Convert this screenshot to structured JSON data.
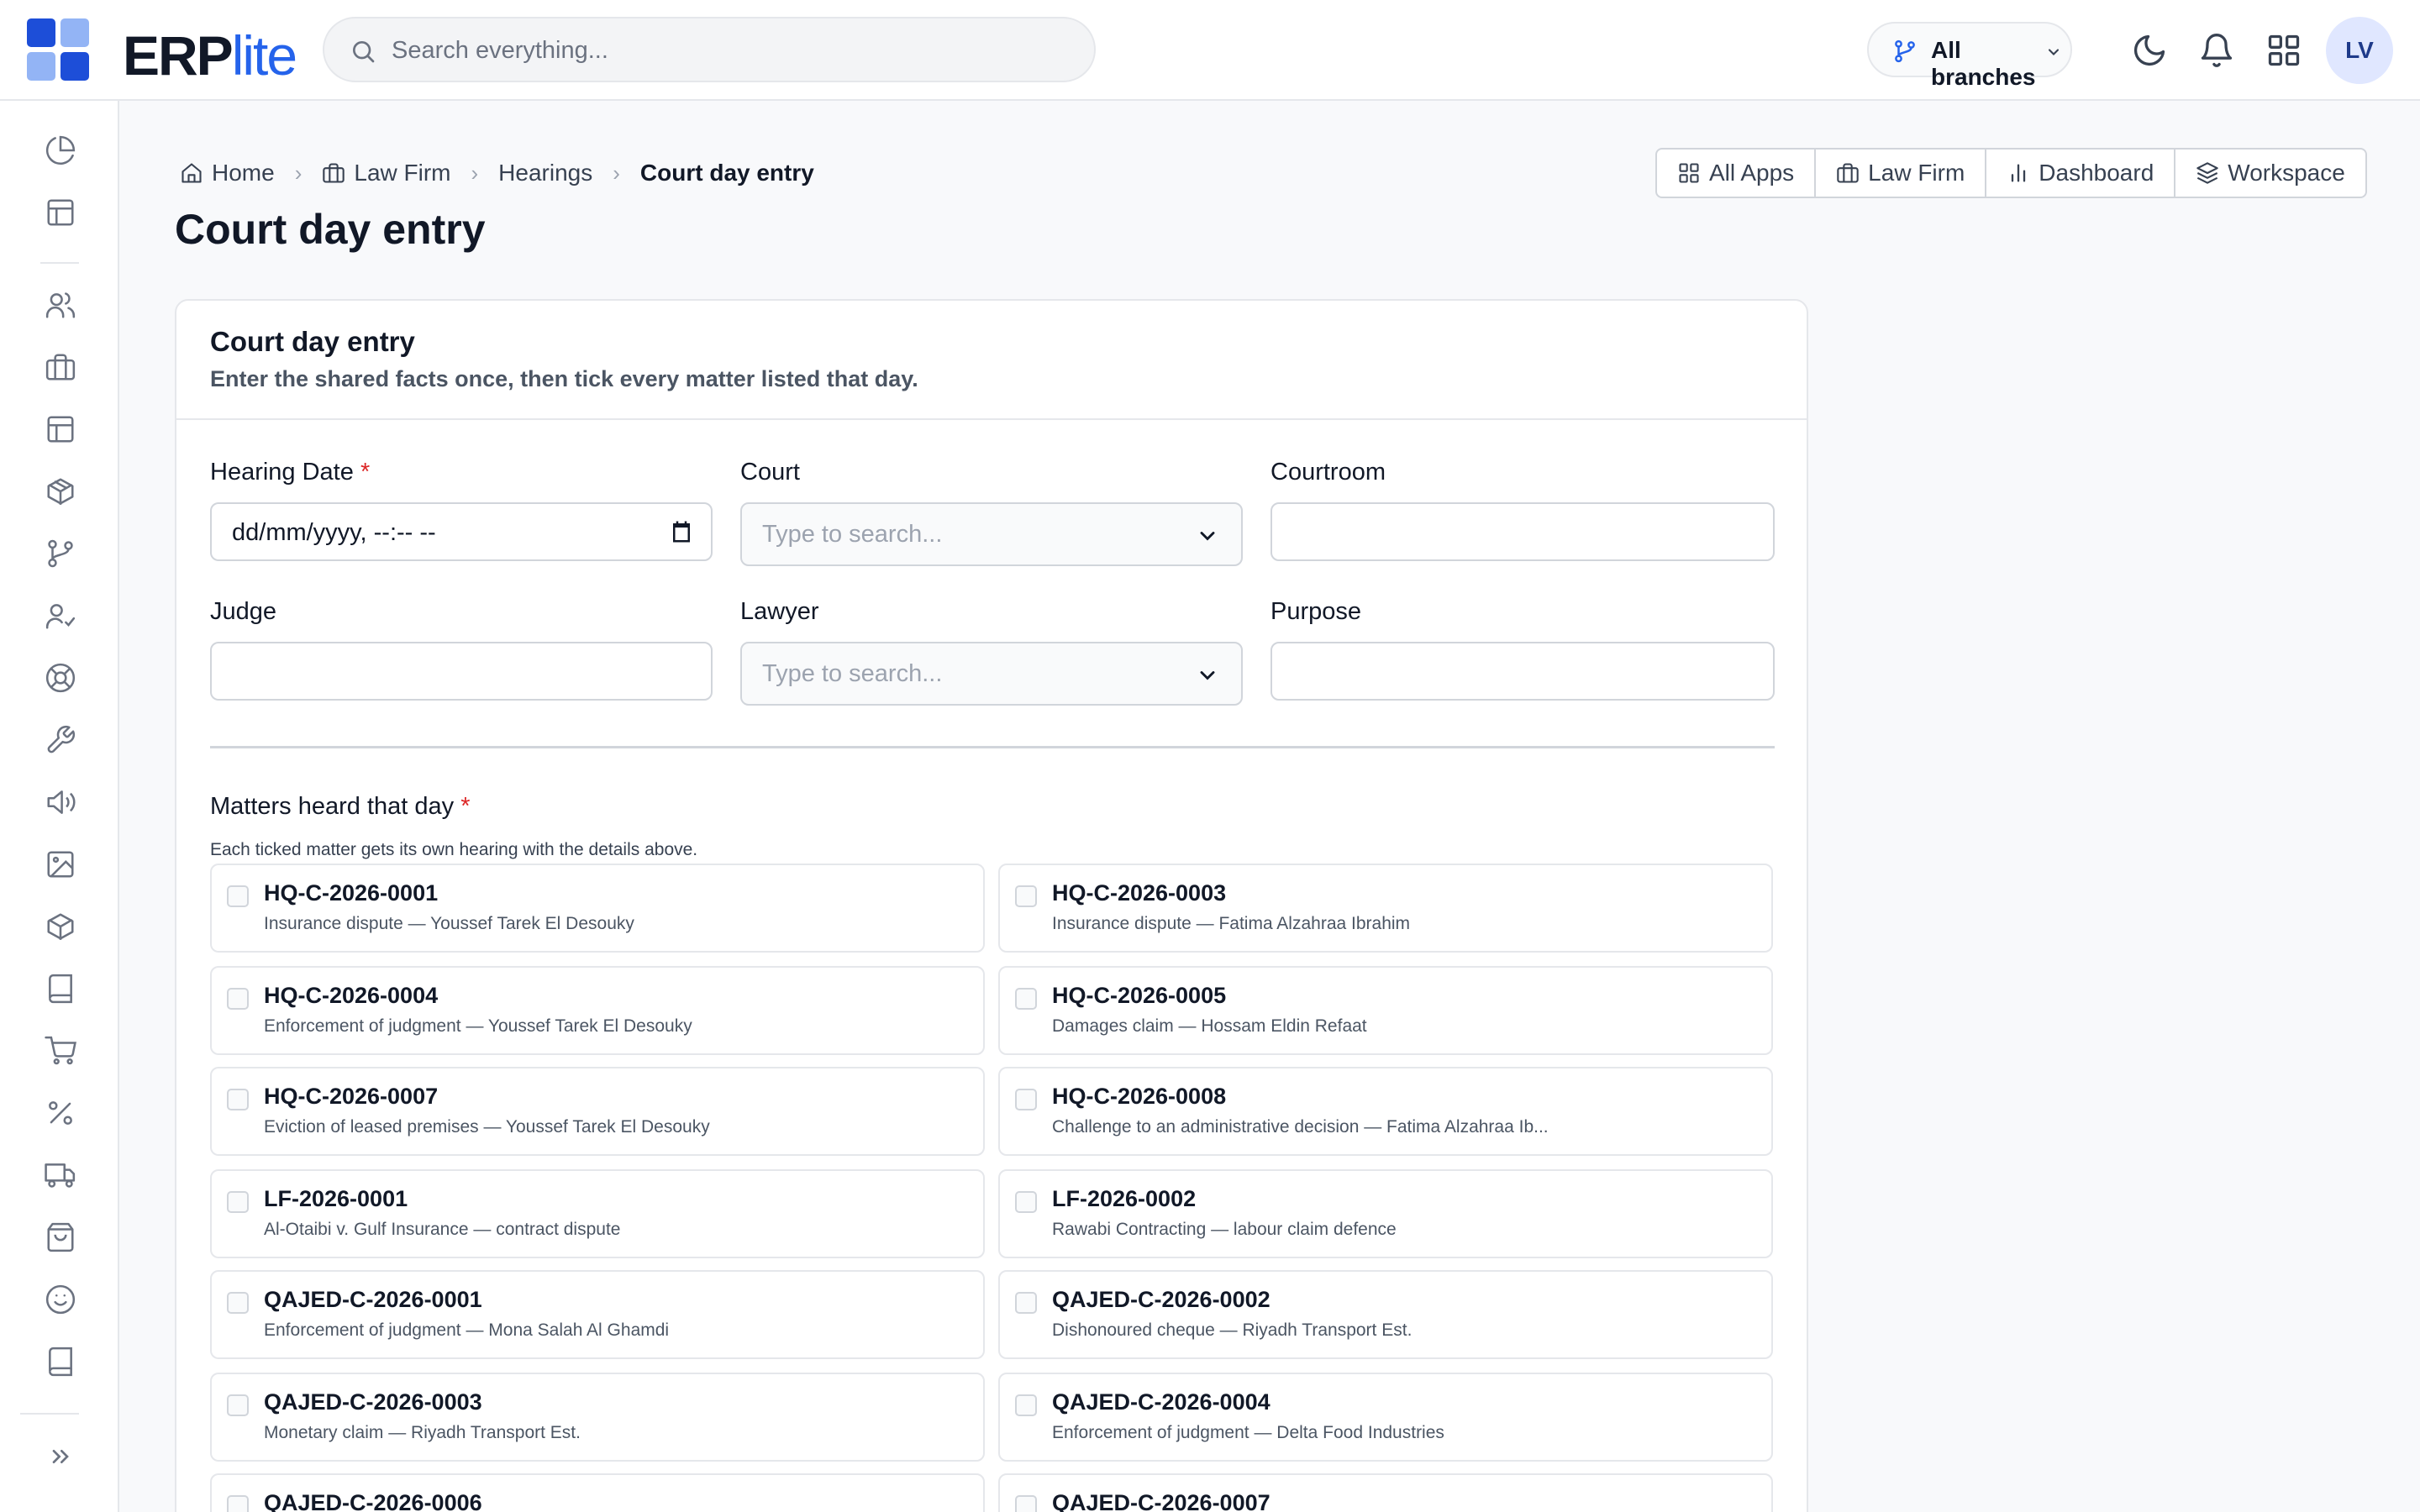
{
  "app": {
    "logo_main": "ERP",
    "logo_accent": "lite"
  },
  "search": {
    "placeholder": "Search everything..."
  },
  "header": {
    "branch_label": "All branches",
    "avatar_initials": "LV"
  },
  "breadcrumb": [
    {
      "label": "Home",
      "icon": "home-icon"
    },
    {
      "label": "Law Firm",
      "icon": "briefcase-icon"
    },
    {
      "label": "Hearings"
    },
    {
      "label": "Court day entry"
    }
  ],
  "quick_links": [
    {
      "label": "All Apps",
      "icon": "grid-icon"
    },
    {
      "label": "Law Firm",
      "icon": "briefcase-icon"
    },
    {
      "label": "Dashboard",
      "icon": "bar-chart-icon"
    },
    {
      "label": "Workspace",
      "icon": "layers-icon"
    }
  ],
  "page": {
    "title": "Court day entry"
  },
  "form": {
    "title": "Court day entry",
    "subtitle": "Enter the shared facts once, then tick every matter listed that day.",
    "fields": {
      "hearing_date": {
        "label": "Hearing Date",
        "required_mark": "*",
        "value": "dd/mm/yyyy, --:-- --"
      },
      "court": {
        "label": "Court",
        "placeholder": "Type to search..."
      },
      "courtroom": {
        "label": "Courtroom",
        "value": ""
      },
      "judge": {
        "label": "Judge",
        "value": ""
      },
      "lawyer": {
        "label": "Lawyer",
        "placeholder": "Type to search..."
      },
      "purpose": {
        "label": "Purpose",
        "value": ""
      }
    },
    "matters": {
      "label": "Matters heard that day",
      "required_mark": "*",
      "hint": "Each ticked matter gets its own hearing with the details above.",
      "items": [
        {
          "code": "HQ-C-2026-0001",
          "desc": "Insurance dispute — Youssef Tarek El Desouky",
          "checked": false
        },
        {
          "code": "HQ-C-2026-0003",
          "desc": "Insurance dispute — Fatima Alzahraa Ibrahim",
          "checked": false
        },
        {
          "code": "HQ-C-2026-0004",
          "desc": "Enforcement of judgment — Youssef Tarek El Desouky",
          "checked": false
        },
        {
          "code": "HQ-C-2026-0005",
          "desc": "Damages claim — Hossam Eldin Refaat",
          "checked": false
        },
        {
          "code": "HQ-C-2026-0007",
          "desc": "Eviction of leased premises — Youssef Tarek El Desouky",
          "checked": false
        },
        {
          "code": "HQ-C-2026-0008",
          "desc": "Challenge to an administrative decision — Fatima Alzahraa Ib...",
          "checked": false
        },
        {
          "code": "LF-2026-0001",
          "desc": "Al-Otaibi v. Gulf Insurance — contract dispute",
          "checked": false
        },
        {
          "code": "LF-2026-0002",
          "desc": "Rawabi Contracting — labour claim defence",
          "checked": false
        },
        {
          "code": "QAJED-C-2026-0001",
          "desc": "Enforcement of judgment — Mona Salah Al Ghamdi",
          "checked": false
        },
        {
          "code": "QAJED-C-2026-0002",
          "desc": "Dishonoured cheque — Riyadh Transport Est.",
          "checked": false
        },
        {
          "code": "QAJED-C-2026-0003",
          "desc": "Monetary claim — Riyadh Transport Est.",
          "checked": false
        },
        {
          "code": "QAJED-C-2026-0004",
          "desc": "Enforcement of judgment — Delta Food Industries",
          "checked": false
        },
        {
          "code": "QAJED-C-2026-0006",
          "desc": "",
          "checked": false
        },
        {
          "code": "QAJED-C-2026-0007",
          "desc": "",
          "checked": false
        }
      ]
    }
  },
  "sidebar": {
    "icons": [
      "pie-chart-icon",
      "layout-icon",
      "users-icon",
      "briefcase-icon",
      "layout-icon",
      "package-icon",
      "git-branch-icon",
      "user-check-icon",
      "life-buoy-icon",
      "wrench-icon",
      "megaphone-icon",
      "image-icon",
      "box-icon",
      "book-icon",
      "cart-icon",
      "percent-icon",
      "truck-icon",
      "shopping-bag-icon",
      "smile-icon",
      "book-icon"
    ],
    "expand_icon": "chevrons-right-icon"
  },
  "colors": {
    "accent": "#2563eb",
    "accent_light": "#93b4f5",
    "required": "#dc2626",
    "border": "#e5e7eb"
  }
}
